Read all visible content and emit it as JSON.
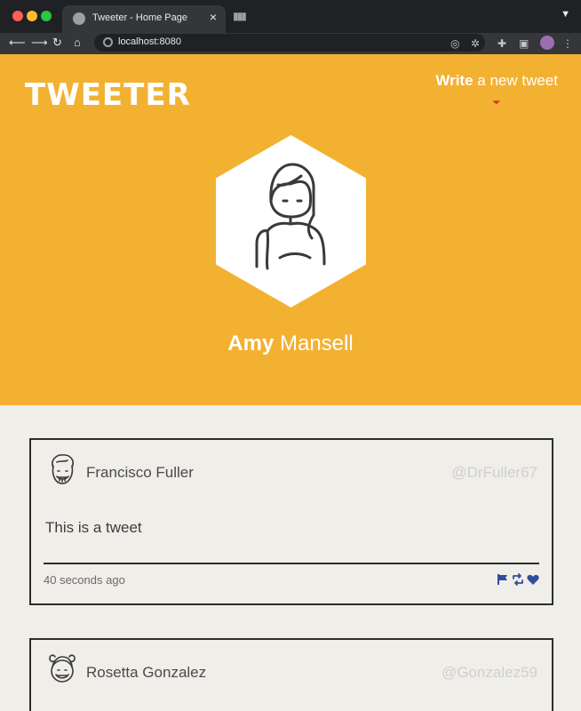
{
  "browser": {
    "tab_title": "Tweeter - Home Page",
    "tab_close": "×",
    "url": "localhost:8080"
  },
  "header": {
    "brand": "TWEETER",
    "compose_bold": "Write",
    "compose_rest": " a new tweet"
  },
  "profile": {
    "first_name": "Amy",
    "last_name": " Mansell"
  },
  "tweets": [
    {
      "name": "Francisco Fuller",
      "handle": "@DrFuller67",
      "text": "This is a tweet",
      "time": "40 seconds ago"
    },
    {
      "name": "Rosetta Gonzalez",
      "handle": "@Gonzalez59"
    }
  ],
  "colors": {
    "accent": "#f3b132",
    "page_bg": "#f0eee9",
    "action_icon": "#2f4d9c"
  }
}
